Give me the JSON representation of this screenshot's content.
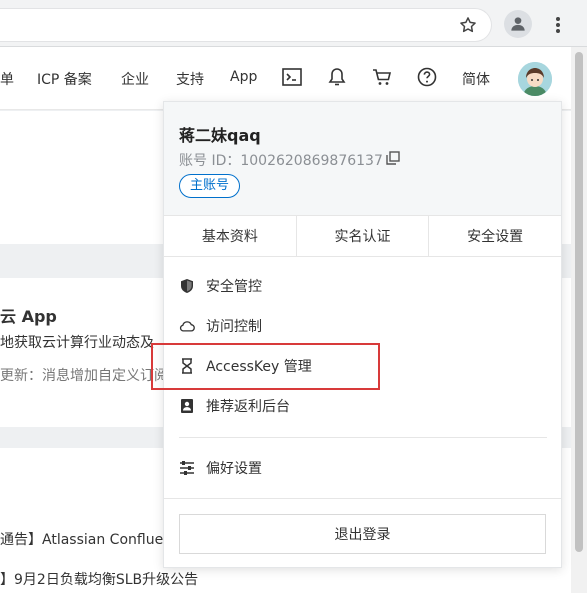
{
  "browser": {
    "star_icon": "star-outline-icon",
    "profile_icon": "account-circle-icon",
    "menu_icon": "kebab-menu-icon"
  },
  "header": {
    "nav": [
      "单",
      "ICP 备案",
      "企业",
      "支持",
      "App"
    ],
    "lang_label": "简体",
    "icons": [
      "terminal-icon",
      "bell-icon",
      "cart-icon",
      "help-icon"
    ]
  },
  "background": {
    "card_title": "云 App",
    "card_desc": "地获取云计算行业动态及",
    "card_update": "更新：消息增加自定义订阅",
    "news": [
      "通告】Atlassian Confluen",
      "】9月2日负载均衡SLB升级公告"
    ]
  },
  "account_panel": {
    "username": "蒋二妹qaq",
    "account_id_label": "账号 ID：",
    "account_id": "1002620869876137",
    "badge": "主账号",
    "tabs": [
      "基本资料",
      "实名认证",
      "安全设置"
    ],
    "menu": [
      {
        "label": "安全管控",
        "icon": "shield-icon"
      },
      {
        "label": "访问控制",
        "icon": "cloud-icon"
      },
      {
        "label": "AccessKey 管理",
        "icon": "key-icon"
      },
      {
        "label": "推荐返利后台",
        "icon": "id-card-icon"
      }
    ],
    "preferences": {
      "label": "偏好设置",
      "icon": "sliders-icon"
    },
    "logout": "退出登录"
  },
  "colors": {
    "accent": "#0070cc",
    "highlight": "#d83a3a"
  }
}
